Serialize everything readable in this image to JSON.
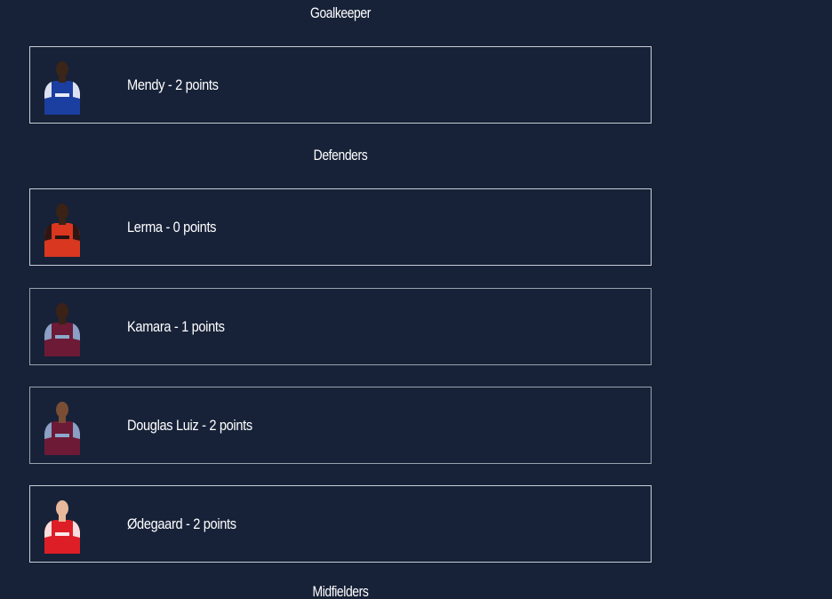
{
  "sections": {
    "goalkeeper": "Goalkeeper",
    "defenders": "Defenders",
    "midfielders": "Midfielders"
  },
  "players": [
    {
      "name": "Mendy",
      "points": "2",
      "label": "Mendy - 2 points",
      "kit_primary": "#1b3fa0",
      "kit_secondary": "#ffffff",
      "skin": "#3b2418"
    },
    {
      "name": "Lerma",
      "points": "0",
      "label": "Lerma - 0 points",
      "kit_primary": "#d9371f",
      "kit_secondary": "#111111",
      "skin": "#3a2216"
    },
    {
      "name": "Kamara",
      "points": "1",
      "label": "Kamara - 1 points",
      "kit_primary": "#6d1a36",
      "kit_secondary": "#8fb8de",
      "skin": "#3a2216"
    },
    {
      "name": "Douglas Luiz",
      "points": "2",
      "label": "Douglas Luiz - 2 points",
      "kit_primary": "#6d1a36",
      "kit_secondary": "#8fb8de",
      "skin": "#7a4e34"
    },
    {
      "name": "Ødegaard",
      "points": "2",
      "label": "Ødegaard - 2 points",
      "kit_primary": "#dd1e26",
      "kit_secondary": "#ffffff",
      "skin": "#e8b89c"
    }
  ]
}
